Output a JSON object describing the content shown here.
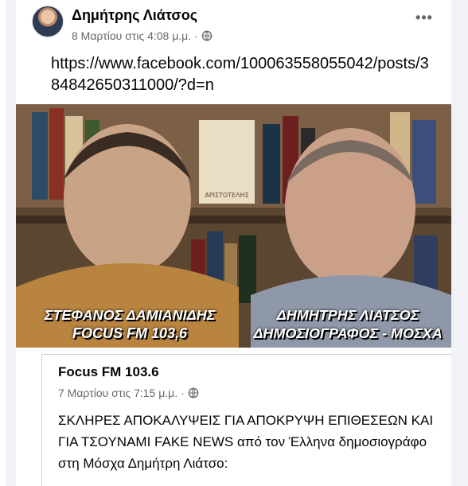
{
  "post": {
    "author": "Δημήτρης Λιάτσος",
    "timestamp": "8 Μαρτίου στις 4:08 μ.μ.",
    "separator": "·",
    "text": "https://www.facebook.com/100063558055042/posts/384842650311000/?d=n",
    "more_icon": "more-options-icon",
    "privacy_icon": "globe-icon"
  },
  "image": {
    "caption_left_line1": "ΣΤΕΦΑΝΟΣ ΔΑΜΙΑΝΙΔΗΣ",
    "caption_left_line2": "FOCUS FM 103,6",
    "caption_right_line1": "ΔΗΜΗΤΡΗΣ ΛΙΑΤΣΟΣ",
    "caption_right_line2": "ΔΗΜΟΣΙΟΓΡΑΦΟΣ - ΜΟΣΧΑ",
    "book_label": "ΑΡΙΣΤΟΤΕΛΗΣ"
  },
  "shared": {
    "source": "Focus FM 103.6",
    "timestamp": "7 Μαρτίου στις 7:15 μ.μ.",
    "separator": "·",
    "text": "ΣΚΛΗΡΕΣ ΑΠΟΚΑΛΥΨΕΙΣ ΓΙΑ ΑΠΟΚΡΥΨΗ ΕΠΙΘΕΣΕΩΝ ΚΑΙ ΓΙΑ ΤΣΟΥΝΑΜΙ FAKE NEWS από τον Έλληνα δημοσιογράφο στη Μόσχα Δημήτρη Λιάτσο:"
  }
}
